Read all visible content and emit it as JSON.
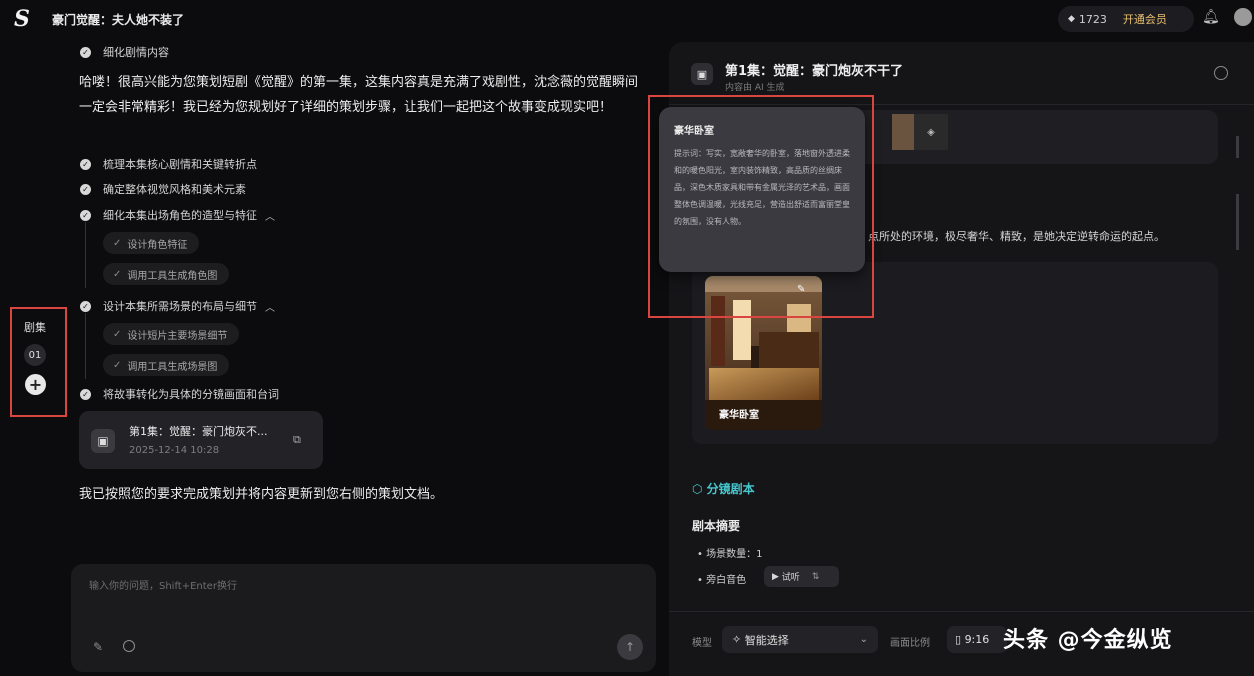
{
  "app": {
    "logo": "S",
    "title": "豪门觉醒：夫人她不装了"
  },
  "header": {
    "credits": "1723",
    "vip_label": "开通会员"
  },
  "rail": {
    "title": "剧集",
    "episode": "01",
    "add": "+"
  },
  "chat": {
    "top_step": "细化剧情内容",
    "intro": "哈喽！很高兴能为您策划短剧《觉醒》的第一集，这集内容真是充满了戏剧性，沈念薇的觉醒瞬间一定会非常精彩！我已经为您规划好了详细的策划步骤，让我们一起把这个故事变成现实吧！",
    "steps": [
      "梳理本集核心剧情和关键转折点",
      "确定整体视觉风格和美术元素",
      "细化本集出场角色的造型与特征",
      "设计本集所需场景的布局与细节",
      "将故事转化为具体的分镜画面和台词"
    ],
    "substeps_a": [
      "设计角色特征",
      "调用工具生成角色图"
    ],
    "substeps_b": [
      "设计短片主要场景细节",
      "调用工具生成场景图"
    ],
    "doc_card": {
      "title": "第1集：觉醒：豪门炮灰不...",
      "date": "2025-12-14 10:28"
    },
    "done_msg": "我已按照您的要求完成策划并将内容更新到您右侧的策划文档。",
    "input_placeholder": "输入你的问题，Shift+Enter换行"
  },
  "panel": {
    "title": "第1集：觉醒：豪门炮灰不干了",
    "subtitle": "内容由 AI 生成",
    "env_text": "点所处的环境，极尽奢华、精致，是她决定逆转命运的起点。",
    "scene_caption": "豪华卧室",
    "tooltip": {
      "title": "豪华卧室",
      "body": "提示词：写实，宽敞奢华的卧室，落地窗外透进柔和的暖色阳光，室内装饰精致，高品质的丝绸床品，深色木质家具和带有金属光泽的艺术品，画面整体色调温暖，光线充足，营造出舒适而富丽堂皇的氛围，没有人物。"
    },
    "storyboard_label": "分镜剧本",
    "summary_title": "剧本摘要",
    "summary_items": [
      "场景数量：1",
      "旁白音色"
    ],
    "tryout_label": "试听",
    "model_label": "模型",
    "model_value": "智能选择",
    "ratio_label": "画面比例",
    "ratio_value": "9:16"
  },
  "watermark": "头条 @今金纵览"
}
